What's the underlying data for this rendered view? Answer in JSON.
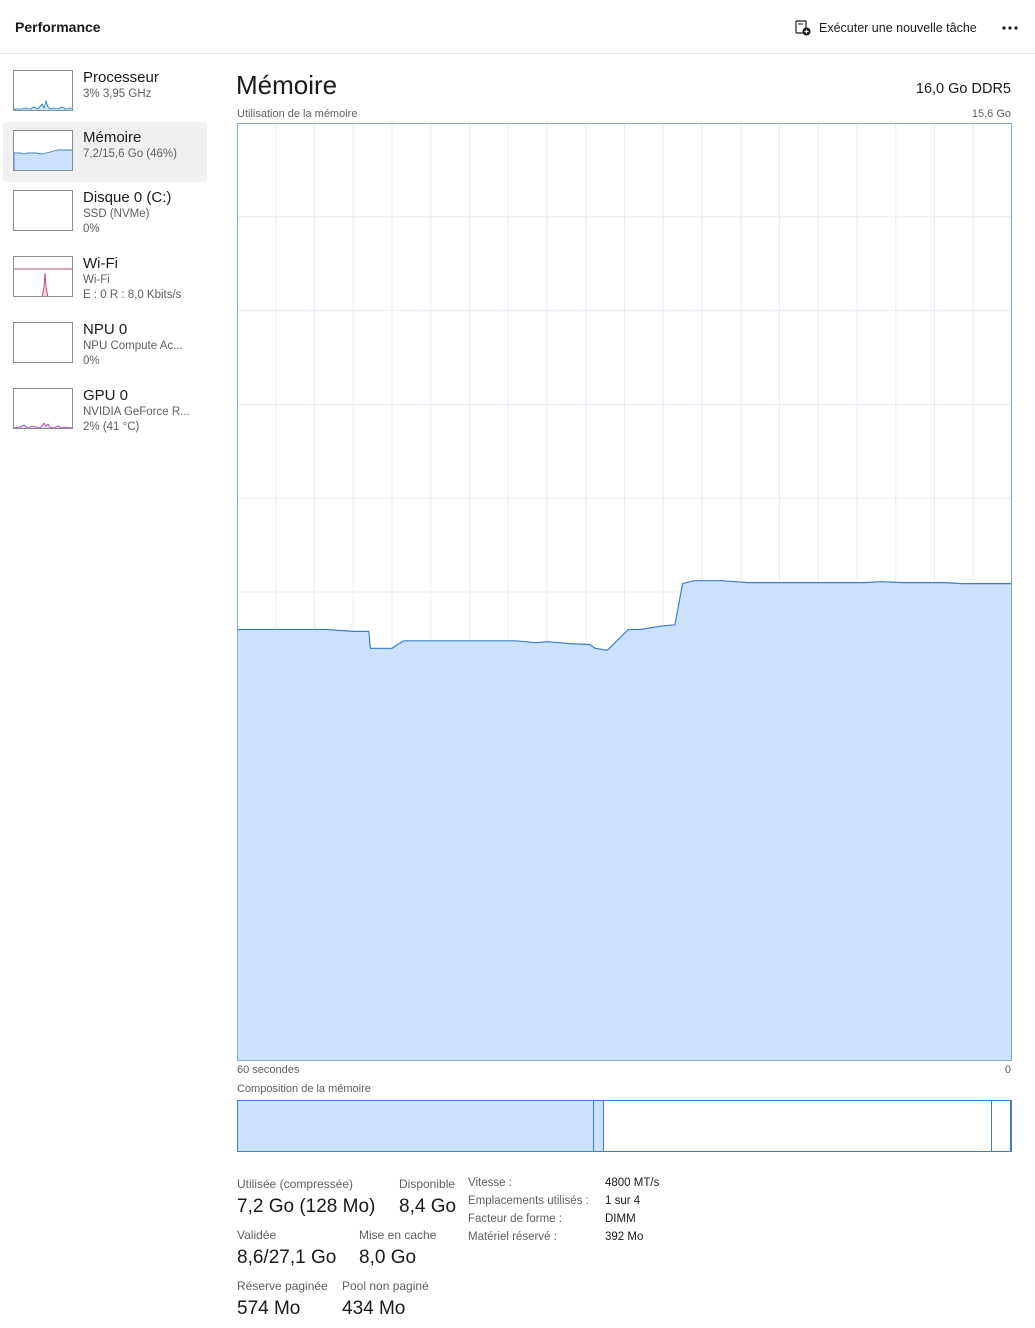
{
  "header": {
    "title": "Performance",
    "run_task_label": "Exécuter une nouvelle tâche",
    "more_label": "⋯"
  },
  "sidebar": {
    "items": [
      {
        "name": "Processeur",
        "sub1": "3% 3,95 GHz",
        "sub2": "",
        "active": false,
        "color": "#117dbb"
      },
      {
        "name": "Mémoire",
        "sub1": "7,2/15,6 Go (46%)",
        "sub2": "",
        "active": true,
        "color": "#3f7fc9"
      },
      {
        "name": "Disque 0 (C:)",
        "sub1": "SSD (NVMe)",
        "sub2": "0%",
        "active": false,
        "color": "#4da60c"
      },
      {
        "name": "Wi-Fi",
        "sub1": "Wi-Fi",
        "sub2": "E : 0 R : 8,0 Kbits/s",
        "active": false,
        "color": "#a74f7a"
      },
      {
        "name": "NPU 0",
        "sub1": "NPU Compute Ac...",
        "sub2": "0%",
        "active": false,
        "color": "#117dbb"
      },
      {
        "name": "GPU 0",
        "sub1": "NVIDIA GeForce R...",
        "sub2": "2% (41 °C)",
        "active": false,
        "color": "#8e44ad"
      }
    ]
  },
  "main": {
    "title": "Mémoire",
    "spec": "16,0 Go DDR5",
    "graph_caption": "Utilisation de la mémoire",
    "graph_max": "15,6 Go",
    "axis_left": "60 secondes",
    "axis_right": "0",
    "composition_label": "Composition de la mémoire"
  },
  "colors": {
    "line": "#3f7fc9",
    "fill": "#cce1fb",
    "grid": "#e6eef6"
  },
  "chart_data": {
    "type": "area",
    "title": "Utilisation de la mémoire",
    "xlabel": "60 secondes",
    "ylabel": "",
    "xlim": [
      60,
      0
    ],
    "ylim": [
      0,
      15.6
    ],
    "unit": "Go",
    "grid": true,
    "x": [
      60,
      58,
      57,
      55,
      50,
      49.8,
      50,
      51,
      52.5,
      53.3,
      53,
      52,
      51.5,
      50.8,
      49,
      48
    ],
    "series": [
      {
        "values": [
          7.2,
          7.2,
          7.2,
          7.2,
          7.2,
          7.2,
          7.22,
          7.22,
          6.9,
          6.9,
          7.05,
          7.1,
          7.1,
          7.1,
          7.1,
          7.09
        ]
      }
    ],
    "points_pct": [
      [
        0,
        46.0
      ],
      [
        5.0,
        46.0
      ],
      [
        11.0,
        46.0
      ],
      [
        15.0,
        45.9
      ],
      [
        17.0,
        45.8
      ],
      [
        15.8,
        45.8
      ],
      [
        15.0,
        46.0
      ],
      [
        17.0,
        45.8
      ],
      [
        15.5,
        45.8
      ],
      [
        17.0,
        45.8
      ],
      [
        15.2,
        46.0
      ],
      [
        17.0,
        45.8
      ]
    ],
    "series_pct": [
      [
        0,
        46.0
      ],
      [
        11.5,
        46.0
      ],
      [
        15.0,
        45.8
      ],
      [
        17.0,
        45.8
      ],
      [
        17.2,
        44.0
      ],
      [
        20.0,
        44.0
      ],
      [
        21.5,
        44.8
      ],
      [
        30.0,
        44.8
      ],
      [
        36.0,
        44.8
      ],
      [
        38.5,
        44.6
      ],
      [
        40.0,
        44.7
      ],
      [
        43.0,
        44.5
      ],
      [
        45.5,
        44.4
      ],
      [
        46.2,
        44.0
      ],
      [
        47.8,
        43.8
      ],
      [
        50.5,
        46.0
      ],
      [
        52.0,
        46.0
      ],
      [
        55.0,
        46.4
      ],
      [
        56.5,
        46.5
      ],
      [
        57.5,
        50.9
      ],
      [
        59.0,
        51.2
      ],
      [
        62.5,
        51.2
      ],
      [
        66.0,
        51.0
      ],
      [
        72.0,
        51.0
      ],
      [
        81.0,
        51.0
      ],
      [
        83.0,
        51.1
      ],
      [
        86.0,
        51.0
      ],
      [
        91.5,
        51.0
      ],
      [
        93.5,
        50.9
      ],
      [
        100.0,
        50.9
      ]
    ]
  },
  "composition": {
    "segments": [
      {
        "name": "used",
        "fraction": 0.461,
        "color": "#cce1fb"
      },
      {
        "name": "modified",
        "fraction": 0.013,
        "color": "#cce1fb"
      },
      {
        "name": "standby",
        "fraction": 0.502,
        "color": "#ffffff"
      },
      {
        "name": "free",
        "fraction": 0.024,
        "color": "#ffffff"
      }
    ]
  },
  "stats": {
    "used_label": "Utilisée (compressée)",
    "used_value": "7,2 Go (128 Mo)",
    "available_label": "Disponible",
    "available_value": "8,4 Go",
    "committed_label": "Validée",
    "committed_value": "8,6/27,1 Go",
    "cached_label": "Mise en cache",
    "cached_value": "8,0 Go",
    "paged_label": "Réserve paginée",
    "paged_value": "574 Mo",
    "nonpaged_label": "Pool non paginé",
    "nonpaged_value": "434 Mo"
  },
  "details": {
    "speed_label": "Vitesse :",
    "speed_value": "4800 MT/s",
    "slots_label": "Emplacements utilisés :",
    "slots_value": "1 sur 4",
    "form_label": "Facteur de forme :",
    "form_value": "DIMM",
    "reserved_label": "Matériel réservé :",
    "reserved_value": "392 Mo"
  }
}
